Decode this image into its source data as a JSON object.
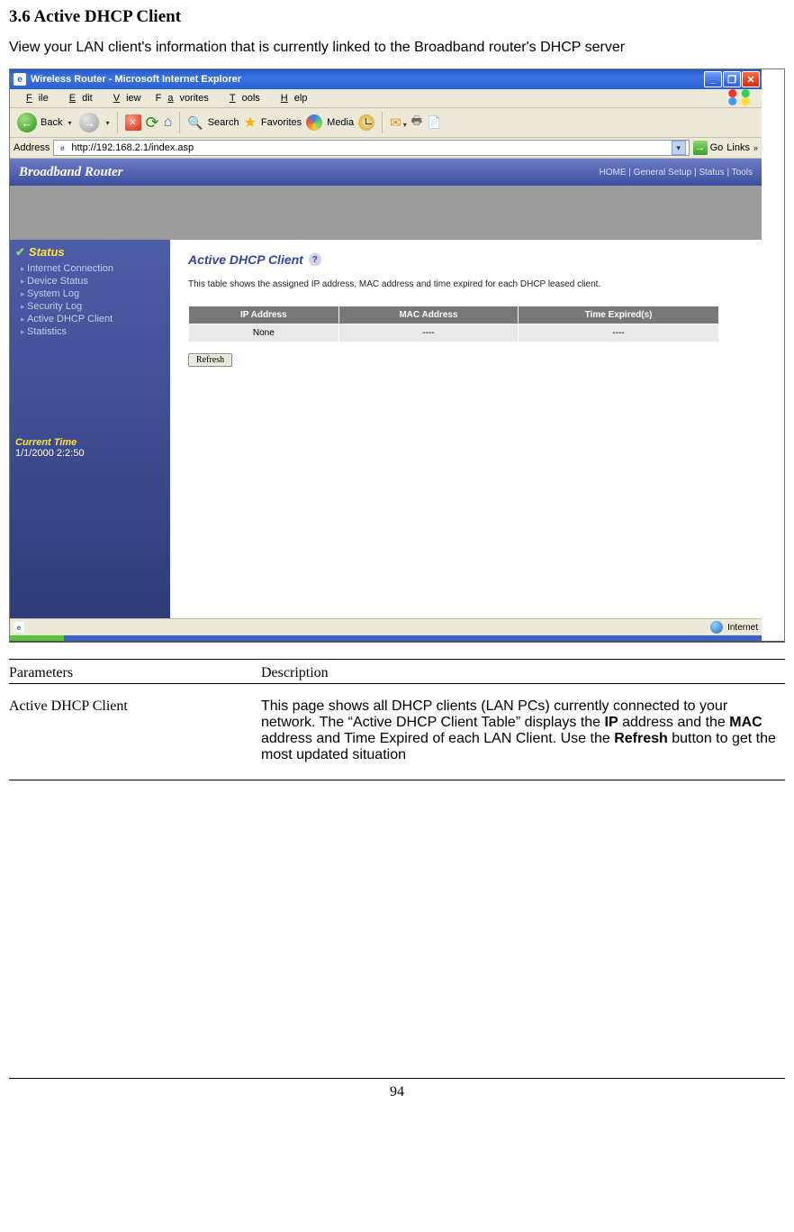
{
  "doc": {
    "section_title": "3.6 Active DHCP Client",
    "intro": "View your LAN client's information that is currently linked to the Broadband router's DHCP server",
    "page_number": "94"
  },
  "titlebar": {
    "text": "Wireless Router - Microsoft Internet Explorer"
  },
  "menu": {
    "file": "File",
    "edit": "Edit",
    "view": "View",
    "favorites": "Favorites",
    "tools": "Tools",
    "help": "Help"
  },
  "toolbar": {
    "back": "Back",
    "search": "Search",
    "favorites": "Favorites",
    "media": "Media"
  },
  "address": {
    "label": "Address",
    "url": "http://192.168.2.1/index.asp",
    "go": "Go",
    "links": "Links"
  },
  "router": {
    "brand": "Broadband Router",
    "nav": "HOME | General Setup | Status | Tools",
    "sidebar_title": "Status",
    "sidebar_items": [
      "Internet Connection",
      "Device Status",
      "System Log",
      "Security Log",
      "Active DHCP Client",
      "Statistics"
    ],
    "current_time_label": "Current Time",
    "current_time": "1/1/2000 2:2:50",
    "page_title": "Active DHCP Client",
    "page_desc": "This table shows the assigned IP address, MAC address and time expired for each DHCP leased client.",
    "cols": [
      "IP Address",
      "MAC Address",
      "Time Expired(s)"
    ],
    "row": [
      "None",
      "----",
      "----"
    ],
    "refresh": "Refresh"
  },
  "status": {
    "internet": "Internet"
  },
  "params": {
    "h1": "Parameters",
    "h2": "Description",
    "name": "Active DHCP Client",
    "desc_pre": "This page shows all DHCP clients (LAN PCs) currently connected to your network. The “Active DHCP Client Table” displays the ",
    "bold_ip": "IP",
    "desc_mid1": " address and the ",
    "bold_mac": "MAC",
    "desc_mid2": " address and Time Expired of each LAN Client. Use the ",
    "bold_refresh": "Refresh",
    "desc_post": " button to get the most updated situation"
  }
}
